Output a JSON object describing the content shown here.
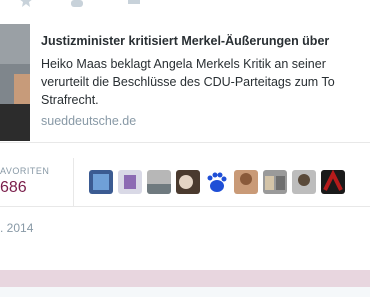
{
  "card": {
    "title": "Justizminister kritisiert Merkel-Äußerungen über",
    "description_line1": "Heiko Maas beklagt Angela Merkels Kritik an seiner",
    "description_line2": "verurteilt die Beschlüsse des CDU-Parteitags zum To",
    "description_line3": "Strafrecht.",
    "domain": "sueddeutsche.de"
  },
  "stats": {
    "favorites_label": "AVORITEN",
    "favorites_count": "686"
  },
  "avatars": [
    {
      "name": "avatar-1",
      "color": "#3b5b92"
    },
    {
      "name": "avatar-2",
      "color": "#d9d9e6"
    },
    {
      "name": "avatar-3",
      "color": "#b7b7b7"
    },
    {
      "name": "avatar-4",
      "color": "#4a3a2e"
    },
    {
      "name": "avatar-5",
      "color": "#1f4fd6"
    },
    {
      "name": "avatar-6",
      "color": "#c99a77"
    },
    {
      "name": "avatar-7",
      "color": "#9a9a9a"
    },
    {
      "name": "avatar-8",
      "color": "#bdbdbd"
    },
    {
      "name": "avatar-9",
      "color": "#b51b1b"
    }
  ],
  "tweet": {
    "date": ". 2014"
  },
  "colors": {
    "favorites_accent": "#7a1d4a",
    "footer_band": "#e8d6df"
  },
  "icons": [
    "star-icon",
    "retweet-icon",
    "follow-icon"
  ]
}
